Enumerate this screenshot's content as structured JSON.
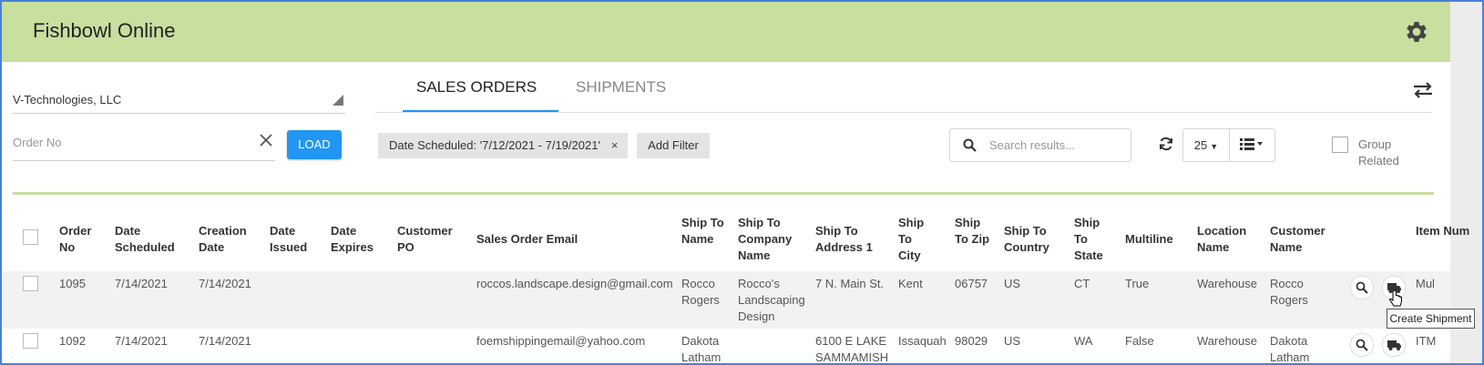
{
  "app": {
    "title": "Fishbowl Online"
  },
  "filters": {
    "company": "V-Technologies, LLC",
    "order_no_placeholder": "Order No",
    "load_label": "LOAD"
  },
  "tabs": [
    {
      "label": "SALES ORDERS",
      "active": true
    },
    {
      "label": "SHIPMENTS",
      "active": false
    }
  ],
  "toolbar": {
    "filter_chip": "Date Scheduled: '7/12/2021 - 7/19/2021'",
    "filter_chip_close": "×",
    "add_filter": "Add Filter",
    "search_placeholder": "Search results...",
    "page_size": "25",
    "group_related": "Group Related"
  },
  "table": {
    "columns": [
      "Order No",
      "Date Scheduled",
      "Creation Date",
      "Date Issued",
      "Date Expires",
      "Customer PO",
      "Sales Order Email",
      "Ship To Name",
      "Ship To Company Name",
      "Ship To Address 1",
      "Ship To City",
      "Ship To Zip",
      "Ship To Country",
      "Ship To State",
      "Multiline",
      "Location Name",
      "Customer Name",
      "Item Num"
    ],
    "rows": [
      {
        "order_no": "1095",
        "date_scheduled": "7/14/2021",
        "creation_date": "7/14/2021",
        "date_issued": "",
        "date_expires": "",
        "customer_po": "",
        "email": "roccos.landscape.design@gmail.com",
        "ship_to_name": "Rocco Rogers",
        "ship_to_company": "Rocco's Landscaping Design",
        "ship_to_address": "7 N. Main St.",
        "ship_to_city": "Kent",
        "ship_to_zip": "06757",
        "ship_to_country": "US",
        "ship_to_state": "CT",
        "multiline": "True",
        "location": "Warehouse",
        "customer": "Rocco Rogers",
        "item_num": "Mul"
      },
      {
        "order_no": "1092",
        "date_scheduled": "7/14/2021",
        "creation_date": "7/14/2021",
        "date_issued": "",
        "date_expires": "",
        "customer_po": "",
        "email": "foemshippingemail@yahoo.com",
        "ship_to_name": "Dakota Latham",
        "ship_to_company": "",
        "ship_to_address": "6100 E LAKE SAMMAMISH",
        "ship_to_city": "Issaquah",
        "ship_to_zip": "98029",
        "ship_to_country": "US",
        "ship_to_state": "WA",
        "multiline": "False",
        "location": "Warehouse",
        "customer": "Dakota Latham",
        "item_num": "ITM"
      }
    ]
  },
  "tooltip": "Create Shipment",
  "icons": {
    "settings": "gear-icon",
    "swap": "swap-arrows-icon",
    "clear": "close-icon",
    "search": "search-icon",
    "refresh": "refresh-icon",
    "view": "list-view-icon",
    "row_view": "magnifier-icon",
    "row_ship": "truck-icon"
  },
  "colors": {
    "header": "#c7df9f",
    "accent": "#2196f3",
    "row_alt": "#f2f2f2"
  }
}
